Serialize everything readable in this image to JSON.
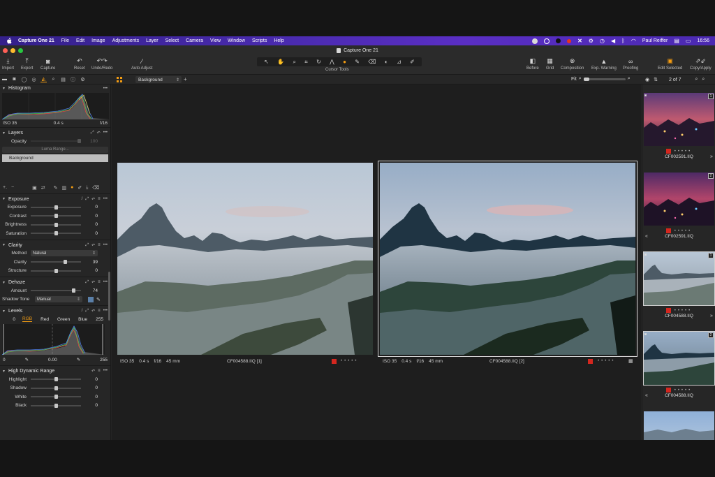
{
  "menubar": {
    "app": "Capture One 21",
    "items": [
      "File",
      "Edit",
      "Image",
      "Adjustments",
      "Layer",
      "Select",
      "Camera",
      "View",
      "Window",
      "Scripts",
      "Help"
    ],
    "user": "Paul Reiffer",
    "time": "16:56"
  },
  "window": {
    "title": "Capture One 21"
  },
  "toolbar": {
    "left": [
      "Import",
      "Export",
      "Capture",
      "Reset",
      "Undo/Redo",
      "Auto Adjust"
    ],
    "cursor_tools_label": "Cursor Tools",
    "right": [
      "Before",
      "Grid",
      "Composition",
      "Exp. Warning",
      "Proofing",
      "Edit Selected",
      "Copy/Apply"
    ]
  },
  "subbar": {
    "layer": "Background",
    "fit": "Fit",
    "count": "2 of 7"
  },
  "histogram": {
    "title": "Histogram",
    "iso": "ISO 35",
    "shutter": "0.4 s",
    "aperture": "f/16"
  },
  "layers": {
    "title": "Layers",
    "opacity_label": "Opacity",
    "opacity_value": "100",
    "luma_range": "Luma Range...",
    "background": "Background"
  },
  "exposure": {
    "title": "Exposure",
    "rows": [
      {
        "label": "Exposure",
        "value": "0",
        "pos": 0.5
      },
      {
        "label": "Contrast",
        "value": "0",
        "pos": 0.5
      },
      {
        "label": "Brightness",
        "value": "0",
        "pos": 0.5
      },
      {
        "label": "Saturation",
        "value": "0",
        "pos": 0.5
      }
    ]
  },
  "clarity": {
    "title": "Clarity",
    "method_label": "Method",
    "method_value": "Natural",
    "rows": [
      {
        "label": "Clarity",
        "value": "39",
        "pos": 0.69
      },
      {
        "label": "Structure",
        "value": "0",
        "pos": 0.5
      }
    ]
  },
  "dehaze": {
    "title": "Dehaze",
    "amount_label": "Amount",
    "amount_value": "74",
    "amount_pos": 0.86,
    "shadow_label": "Shadow Tone",
    "shadow_value": "Manual",
    "shadow_color": "#5a7fa8"
  },
  "levels": {
    "title": "Levels",
    "input_low": "0",
    "input_high": "255",
    "tabs": [
      "RGB",
      "Red",
      "Green",
      "Blue"
    ],
    "output_low": "0",
    "mid": "0.00",
    "output_high": "255"
  },
  "hdr": {
    "title": "High Dynamic Range",
    "rows": [
      {
        "label": "Highlight",
        "value": "0",
        "pos": 0.5
      },
      {
        "label": "Shadow",
        "value": "0",
        "pos": 0.5
      },
      {
        "label": "White",
        "value": "0",
        "pos": 0.5
      },
      {
        "label": "Black",
        "value": "0",
        "pos": 0.5
      }
    ]
  },
  "viewer": {
    "left": {
      "iso": "ISO 35",
      "shutter": "0.4 s",
      "aperture": "f/16",
      "focal": "45 mm",
      "name": "CF004588.IIQ [1]"
    },
    "right": {
      "iso": "ISO 35",
      "shutter": "0.4 s",
      "aperture": "f/16",
      "focal": "45 mm",
      "name": "CF004588.IIQ [2]"
    }
  },
  "browser": {
    "thumbs": [
      {
        "name": "CF002591.IIQ",
        "num": "1",
        "kind": "city"
      },
      {
        "name": "CF002591.IIQ",
        "num": "2",
        "kind": "city"
      },
      {
        "name": "CF004588.IIQ",
        "num": "1",
        "kind": "mist"
      },
      {
        "name": "CF004588.IIQ",
        "num": "2",
        "kind": "mist2"
      }
    ]
  },
  "colors": {
    "accent": "#f39c12",
    "red_tag": "#d4271f"
  }
}
